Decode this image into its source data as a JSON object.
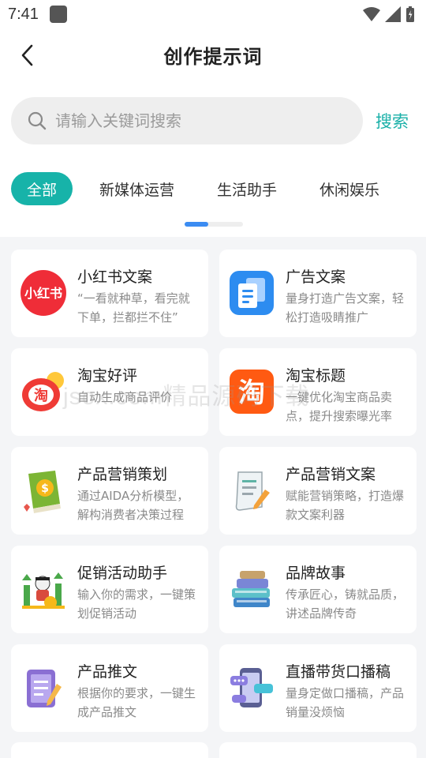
{
  "status_bar": {
    "time": "7:41"
  },
  "header": {
    "title": "创作提示词"
  },
  "search": {
    "placeholder": "请输入关键词搜索",
    "button": "搜索"
  },
  "tabs": [
    {
      "label": "全部",
      "active": true
    },
    {
      "label": "新媒体运营",
      "active": false
    },
    {
      "label": "生活助手",
      "active": false
    },
    {
      "label": "休闲娱乐",
      "active": false
    }
  ],
  "cards": [
    {
      "title": "小红书文案",
      "desc": "“一看就种草，看完就下单，拦都拦不住”",
      "icon": "xiaohongshu-icon"
    },
    {
      "title": "广告文案",
      "desc": "量身打造广告文案，轻松打造吸睛推广",
      "icon": "document-copy-icon"
    },
    {
      "title": "淘宝好评",
      "desc": "自动生成商品评价",
      "icon": "taobao-sun-icon"
    },
    {
      "title": "淘宝标题",
      "desc": "一键优化淘宝商品卖点，提升搜索曝光率",
      "icon": "taobao-icon"
    },
    {
      "title": "产品营销策划",
      "desc": "通过AIDA分析模型，解构消费者决策过程",
      "icon": "money-book-icon"
    },
    {
      "title": "产品营销文案",
      "desc": "赋能营销策略，打造爆款文案利器",
      "icon": "scroll-pen-icon"
    },
    {
      "title": "促销活动助手",
      "desc": "输入你的需求，一键策划促销活动",
      "icon": "growth-chart-icon"
    },
    {
      "title": "品牌故事",
      "desc": "传承匠心，铸就品质，讲述品牌传奇",
      "icon": "book-stack-icon"
    },
    {
      "title": "产品推文",
      "desc": "根据你的要求，一键生成产品推文",
      "icon": "notepad-pen-icon"
    },
    {
      "title": "直播带货口播稿",
      "desc": "量身定做口播稿，产品销量没烦恼",
      "icon": "phone-chat-icon"
    }
  ],
  "watermark": "jsox.com精品源码下载",
  "colors": {
    "accent": "#17b3a9",
    "indicator": "#3b8cf2",
    "xiaohongshu": "#ef2d38",
    "taobao": "#ff5a12"
  }
}
